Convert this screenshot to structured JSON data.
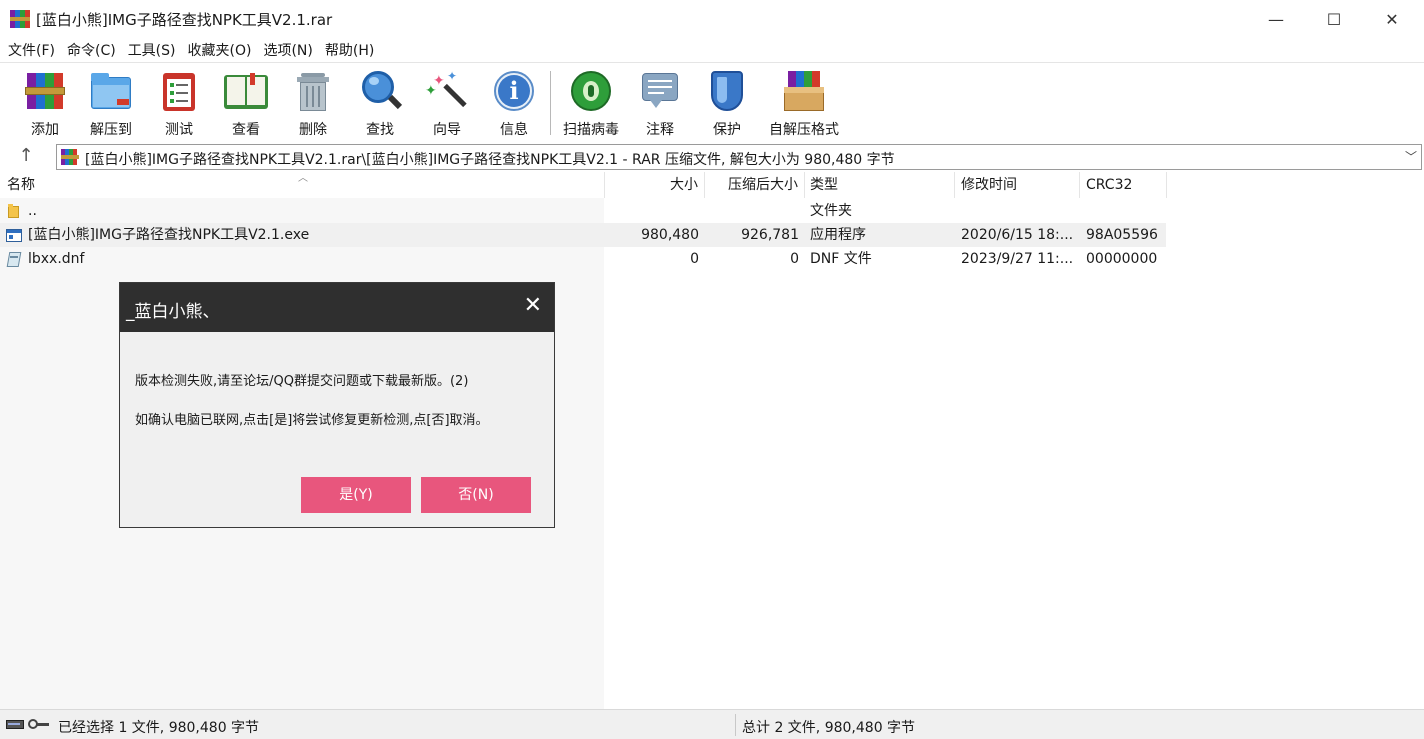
{
  "window": {
    "title": "[蓝白小熊]IMG子路径查找NPK工具V2.1.rar",
    "minimize_glyph": "—",
    "maximize_glyph": "☐",
    "close_glyph": "✕"
  },
  "menu": [
    "文件(F)",
    "命令(C)",
    "工具(S)",
    "收藏夹(O)",
    "选项(N)",
    "帮助(H)"
  ],
  "toolbar": [
    {
      "label": "添加",
      "icon": "add-archive-icon"
    },
    {
      "label": "解压到",
      "icon": "extract-folder-icon"
    },
    {
      "label": "测试",
      "icon": "test-clipboard-icon"
    },
    {
      "label": "查看",
      "icon": "view-book-icon"
    },
    {
      "label": "删除",
      "icon": "trash-icon"
    },
    {
      "label": "查找",
      "icon": "magnifier-icon"
    },
    {
      "label": "向导",
      "icon": "wizard-wand-icon"
    },
    {
      "label": "信息",
      "icon": "info-icon"
    },
    {
      "label": "扫描病毒",
      "icon": "virus-scan-icon"
    },
    {
      "label": "注释",
      "icon": "comment-icon"
    },
    {
      "label": "保护",
      "icon": "shield-icon"
    },
    {
      "label": "自解压格式",
      "icon": "sfx-box-icon"
    }
  ],
  "address": {
    "up_glyph": "↑",
    "path": "[蓝白小熊]IMG子路径查找NPK工具V2.1.rar\\[蓝白小熊]IMG子路径查找NPK工具V2.1 - RAR 压缩文件, 解包大小为 980,480 字节",
    "dropdown_glyph": "﹀"
  },
  "columns": {
    "name": "名称",
    "size": "大小",
    "packed": "压缩后大小",
    "type": "类型",
    "modified": "修改时间",
    "crc": "CRC32"
  },
  "files": [
    {
      "name": "..",
      "size": "",
      "packed": "",
      "type": "文件夹",
      "modified": "",
      "crc": "",
      "icon": "folder-icon"
    },
    {
      "name": "[蓝白小熊]IMG子路径查找NPK工具V2.1.exe",
      "size": "980,480",
      "packed": "926,781",
      "type": "应用程序",
      "modified": "2020/6/15 18:...",
      "crc": "98A05596",
      "icon": "exe-icon",
      "selected": true
    },
    {
      "name": "lbxx.dnf",
      "size": "0",
      "packed": "0",
      "type": "DNF 文件",
      "modified": "2023/9/27 11:...",
      "crc": "00000000",
      "icon": "dnf-file-icon"
    }
  ],
  "status": {
    "left": "已经选择 1 文件, 980,480 字节",
    "right": "总计 2 文件, 980,480 字节"
  },
  "dialog": {
    "title": "_蓝白小熊、",
    "close_glyph": "✕",
    "message1": "版本检测失败,请至论坛/QQ群提交问题或下载最新版。(2)",
    "message2": "如确认电脑已联网,点击[是]将尝试修复更新检测,点[否]取消。",
    "yes_label": "是(Y)",
    "no_label": "否(N)",
    "button_color": "#e8567d"
  }
}
